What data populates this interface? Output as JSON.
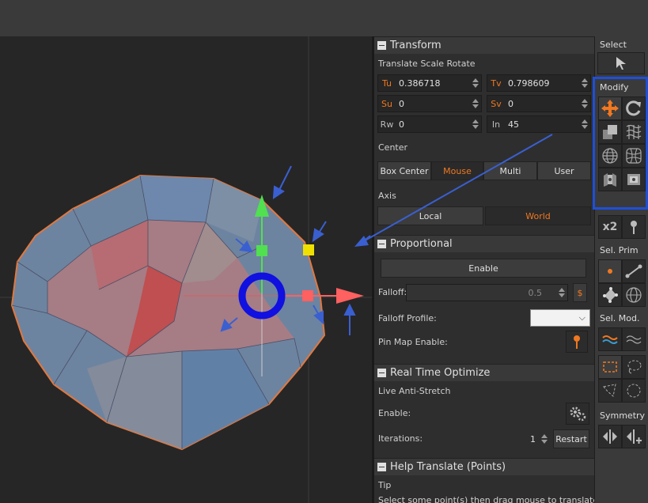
{
  "transform": {
    "title": "Transform",
    "modes_label": "Translate Scale Rotate",
    "fields": [
      {
        "tag": "Tu",
        "value": "0.386718",
        "color": "orange"
      },
      {
        "tag": "Tv",
        "value": "0.798609",
        "color": "orange"
      },
      {
        "tag": "Su",
        "value": "0",
        "color": "orange"
      },
      {
        "tag": "Sv",
        "value": "0",
        "color": "orange"
      },
      {
        "tag": "Rw",
        "value": "0",
        "color": "gray"
      },
      {
        "tag": "In",
        "value": "45",
        "color": "gray"
      }
    ],
    "center_label": "Center",
    "center_buttons": [
      "Box Center",
      "Mouse",
      "Multi",
      "User"
    ],
    "center_active": "Mouse",
    "axis_label": "Axis",
    "axis_buttons": [
      "Local",
      "World"
    ],
    "axis_active": "World"
  },
  "proportional": {
    "title": "Proportional",
    "enable_label": "Enable",
    "falloff_label": "Falloff:",
    "falloff_value": "0.5",
    "falloff_unit": "$",
    "falloff_profile_label": "Falloff Profile:",
    "pin_map_label": "Pin Map Enable:"
  },
  "optimize": {
    "title": "Real Time Optimize",
    "anti_stretch_label": "Live Anti-Stretch",
    "enable_label": "Enable:",
    "iterations_label": "Iterations:",
    "iterations_value": "1",
    "restart_label": "Restart"
  },
  "help": {
    "title": "Help Translate (Points)",
    "tip_label": "Tip",
    "tip_text": "Select some point(s) then drag mouse to translate"
  },
  "tools": {
    "select_label": "Select",
    "modify_label": "Modify",
    "x2_label": "x2",
    "sel_prim_label": "Sel. Prim",
    "sel_mod_label": "Sel. Mod.",
    "symmetry_label": "Symmetry"
  },
  "colors": {
    "accent": "#f07820",
    "highlight_box": "#1e4fd8",
    "gizmo_blue": "#1010e0",
    "gizmo_green": "#40e040",
    "gizmo_red": "#ff5050"
  }
}
